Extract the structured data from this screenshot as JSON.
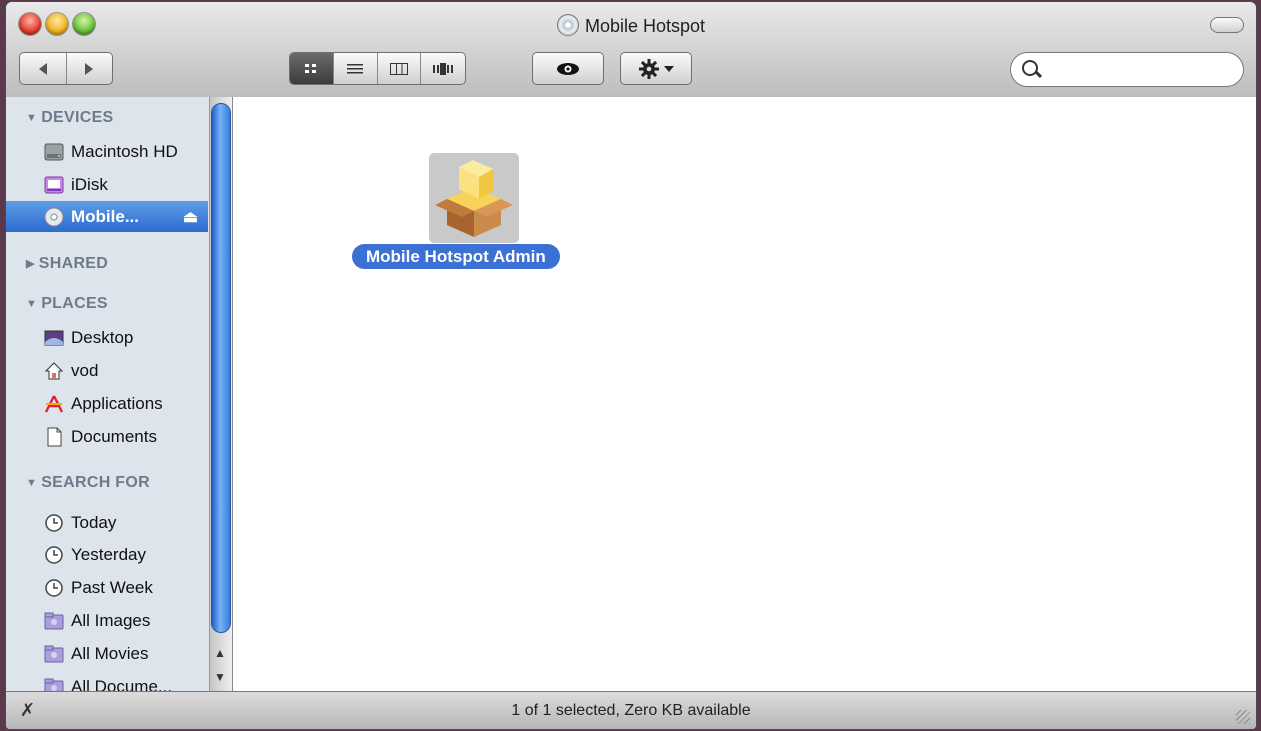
{
  "window": {
    "title": "Mobile Hotspot"
  },
  "toolbar": {
    "back_icon": "back-arrow-icon",
    "forward_icon": "forward-arrow-icon",
    "view_modes": [
      "icon-view",
      "list-view",
      "column-view",
      "cover-flow-view"
    ],
    "active_view": "icon-view",
    "quicklook_icon": "eye-icon",
    "action_icon": "gear-icon",
    "search": {
      "value": "",
      "placeholder": ""
    }
  },
  "sidebar": {
    "sections": [
      {
        "header": "DEVICES",
        "expanded": true,
        "items": [
          {
            "label": "Macintosh HD",
            "icon": "hard-drive-icon"
          },
          {
            "label": "iDisk",
            "icon": "idisk-icon"
          },
          {
            "label": "Mobile...",
            "icon": "cd-disc-icon",
            "selected": true
          }
        ]
      },
      {
        "header": "SHARED",
        "expanded": false,
        "items": []
      },
      {
        "header": "PLACES",
        "expanded": true,
        "items": [
          {
            "label": "Desktop",
            "icon": "desktop-icon"
          },
          {
            "label": "vod",
            "icon": "home-icon"
          },
          {
            "label": "Applications",
            "icon": "applications-icon"
          },
          {
            "label": "Documents",
            "icon": "documents-icon"
          }
        ]
      },
      {
        "header": "SEARCH FOR",
        "expanded": true,
        "items": [
          {
            "label": "Today",
            "icon": "clock-icon"
          },
          {
            "label": "Yesterday",
            "icon": "clock-icon"
          },
          {
            "label": "Past Week",
            "icon": "clock-icon"
          },
          {
            "label": "All Images",
            "icon": "smart-folder-icon"
          },
          {
            "label": "All Movies",
            "icon": "smart-folder-icon"
          },
          {
            "label": "All Docume...",
            "icon": "smart-folder-icon"
          }
        ]
      }
    ]
  },
  "content": {
    "items": [
      {
        "label": "Mobile Hotspot Admin",
        "icon": "package-installer-icon",
        "selected": true
      }
    ]
  },
  "status_bar": {
    "text": "1 of 1 selected, Zero KB available"
  },
  "colors": {
    "selection": "#3b71d4",
    "sidebar_bg": "#dde4ec",
    "sidebar_header": "#6d7b8b"
  }
}
